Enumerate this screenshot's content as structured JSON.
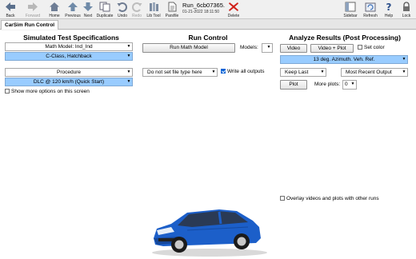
{
  "toolbar": {
    "back": "Back",
    "forward": "Forward",
    "home": "Home",
    "previous": "Previous",
    "next": "Next",
    "duplicate": "Duplicate",
    "undo": "Undo",
    "redo": "Redo",
    "lib_tool": "Lib Tool",
    "parsfile": "Parsfile",
    "run_name": "Run_6cb07365.",
    "run_date": "01-21-2022 18:11:50",
    "delete": "Delete",
    "sidebar": "Sidebar",
    "refresh": "Refresh",
    "help": "Help",
    "lock": "Lock"
  },
  "tab": {
    "label": "CarSim Run Control"
  },
  "sim_specs": {
    "heading": "Simulated Test Specifications",
    "math_model_label": "Math Model: Ind_Ind",
    "math_model_value": "C-Class, Hatchback",
    "procedure_label": "Procedure",
    "procedure_value": "DLC @ 120 km/h (Quick Start)",
    "show_more": "Show more options on this screen"
  },
  "run_control": {
    "heading": "Run Control",
    "run_button": "Run Math Model",
    "models_label": "Models:",
    "file_type": "Do not set file type here",
    "write_all": "Write all outputs"
  },
  "analyze": {
    "heading": "Analyze Results (Post Processing)",
    "video": "Video",
    "video_plot": "Video + Plot",
    "set_color": "Set color",
    "video_selection": "13 deg. Azimuth. Veh. Ref.",
    "keep_last": "Keep Last",
    "most_recent": "Most Recent Output",
    "plot": "Plot",
    "more_plots_label": "More plots:",
    "more_plots_value": "0",
    "overlay": "Overlay videos and plots with other runs"
  },
  "colors": {
    "selection_blue": "#99ccff",
    "car_blue": "#1c5fc9"
  }
}
